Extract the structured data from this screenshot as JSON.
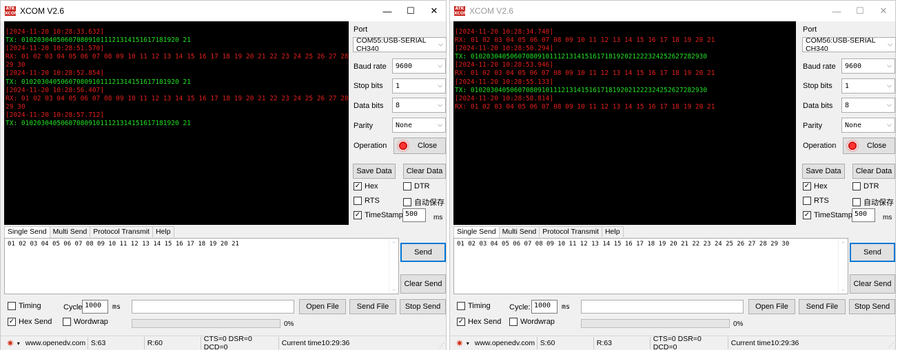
{
  "windows": [
    {
      "title": "XCOM V2.6",
      "logo_text": "ATK XCOM",
      "window_controls": {
        "minimize": "—",
        "maximize": "☐",
        "close": "✕"
      },
      "log": [
        {
          "kind": "ts",
          "text": "[2024-11-20 10:28:33.632]"
        },
        {
          "kind": "tx",
          "text": "TX: 0102030405060708091011121314151617181920 21"
        },
        {
          "kind": "ts",
          "text": "[2024-11-20 10:28:51.570]"
        },
        {
          "kind": "rx",
          "text": "RX: 01 02 03 04 05 06 07 08 09 10 11 12 13 14 15 16 17 18 19 20 21 22 23 24 25 26 27 28 29 30"
        },
        {
          "kind": "ts",
          "text": "[2024-11-20 10:28:52.854]"
        },
        {
          "kind": "tx",
          "text": "TX: 0102030405060708091011121314151617181920 21"
        },
        {
          "kind": "ts",
          "text": "[2024-11-20 10:28:56.407]"
        },
        {
          "kind": "rx",
          "text": "RX: 01 02 03 04 05 06 07 08 09 10 11 12 13 14 15 16 17 18 19 20 21 22 23 24 25 26 27 28 29 30"
        },
        {
          "kind": "ts",
          "text": "[2024-11-20 10:28:57.712]"
        },
        {
          "kind": "tx",
          "text": "TX: 0102030405060708091011121314151617181920 21"
        }
      ],
      "port_label": "Port",
      "port_value": "COM55:USB-SERIAL CH340",
      "baud_label": "Baud rate",
      "baud_value": "9600",
      "stop_label": "Stop bits",
      "stop_value": "1",
      "data_label": "Data bits",
      "data_value": "8",
      "parity_label": "Parity",
      "parity_value": "None",
      "operation_label": "Operation",
      "operation_button": "Close",
      "save_data": "Save Data",
      "clear_data": "Clear Data",
      "hex_label": "Hex",
      "hex_checked": "✓",
      "dtr_label": "DTR",
      "dtr_checked": "",
      "rts_label": "RTS",
      "rts_checked": "",
      "autosave_label": "自动保存",
      "autosave_checked": "",
      "timestamp_label": "TimeStamp",
      "timestamp_checked": "✓",
      "timestamp_value": "500",
      "timestamp_unit": "ms",
      "tabs": [
        "Single Send",
        "Multi Send",
        "Protocol Transmit",
        "Help"
      ],
      "send_text": "01 02 03 04 05 06 07 08 09 10 11 12 13 14 15 16 17 18 19 20 21",
      "send_button": "Send",
      "clear_send": "Clear Send",
      "timing_label": "Timing",
      "timing_checked": "",
      "cycle_label": "Cycle:",
      "cycle_value": "1000",
      "cycle_unit": "ms",
      "file_path": "",
      "open_file": "Open File",
      "send_file": "Send File",
      "stop_send": "Stop Send",
      "hexsend_label": "Hex Send",
      "hexsend_checked": "✓",
      "wordwrap_label": "Wordwrap",
      "wordwrap_checked": "",
      "progress_text": "0%",
      "progress_fraction": 0,
      "status": {
        "url": "www.openedv.com",
        "sent": "S:63",
        "recv": "R:60",
        "signals": "CTS=0 DSR=0 DCD=0",
        "time": "Current time10:29:36"
      },
      "accent_color": "#0078d7"
    },
    {
      "title": "XCOM V2.6",
      "logo_text": "ATK XCOM",
      "window_controls": {
        "minimize": "—",
        "maximize": "☐",
        "close": "✕"
      },
      "log": [
        {
          "kind": "ts",
          "text": "[2024-11-20 10:28:34.740]"
        },
        {
          "kind": "rx",
          "text": "RX: 01 02 03 04 05 06 07 08 09 10 11 12 13 14 15 16 17 18 19 20 21"
        },
        {
          "kind": "ts",
          "text": "[2024-11-20 10:28:50.294]"
        },
        {
          "kind": "tx",
          "text": "TX: 010203040506070809101112131415161718192021222324252627282930"
        },
        {
          "kind": "ts",
          "text": "[2024-11-20 10:28:53.946]"
        },
        {
          "kind": "rx",
          "text": "RX: 01 02 03 04 05 06 07 08 09 10 11 12 13 14 15 16 17 18 19 20 21"
        },
        {
          "kind": "ts",
          "text": "[2024-11-20 10:28:55.133]"
        },
        {
          "kind": "tx",
          "text": "TX: 010203040506070809101112131415161718192021222324252627282930"
        },
        {
          "kind": "ts",
          "text": "[2024-11-20 10:28:58.814]"
        },
        {
          "kind": "rx",
          "text": "RX: 01 02 03 04 05 06 07 08 09 10 11 12 13 14 15 16 17 18 19 20 21"
        }
      ],
      "port_label": "Port",
      "port_value": "COM56:USB-SERIAL CH340",
      "baud_label": "Baud rate",
      "baud_value": "9600",
      "stop_label": "Stop bits",
      "stop_value": "1",
      "data_label": "Data bits",
      "data_value": "8",
      "parity_label": "Parity",
      "parity_value": "None",
      "operation_label": "Operation",
      "operation_button": "Close",
      "save_data": "Save Data",
      "clear_data": "Clear Data",
      "hex_label": "Hex",
      "hex_checked": "✓",
      "dtr_label": "DTR",
      "dtr_checked": "",
      "rts_label": "RTS",
      "rts_checked": "",
      "autosave_label": "自动保存",
      "autosave_checked": "",
      "timestamp_label": "TimeStamp",
      "timestamp_checked": "✓",
      "timestamp_value": "500",
      "timestamp_unit": "ms",
      "tabs": [
        "Single Send",
        "Multi Send",
        "Protocol Transmit",
        "Help"
      ],
      "send_text": "01 02 03 04 05 06 07 08 09 10 11 12 13 14 15 16 17 18 19 20 21 22 23 24 25 26 27 28 29 30",
      "send_button": "Send",
      "clear_send": "Clear Send",
      "timing_label": "Timing",
      "timing_checked": "",
      "cycle_label": "Cycle:",
      "cycle_value": "1000",
      "cycle_unit": "ms",
      "file_path": "",
      "open_file": "Open File",
      "send_file": "Send File",
      "stop_send": "Stop Send",
      "hexsend_label": "Hex Send",
      "hexsend_checked": "✓",
      "wordwrap_label": "Wordwrap",
      "wordwrap_checked": "",
      "progress_text": "0%",
      "progress_fraction": 0,
      "status": {
        "url": "www.openedv.com",
        "sent": "S:60",
        "recv": "R:63",
        "signals": "CTS=0 DSR=0 DCD=0",
        "time": "Current time10:29:36"
      },
      "accent_color": "#0078d7"
    }
  ]
}
